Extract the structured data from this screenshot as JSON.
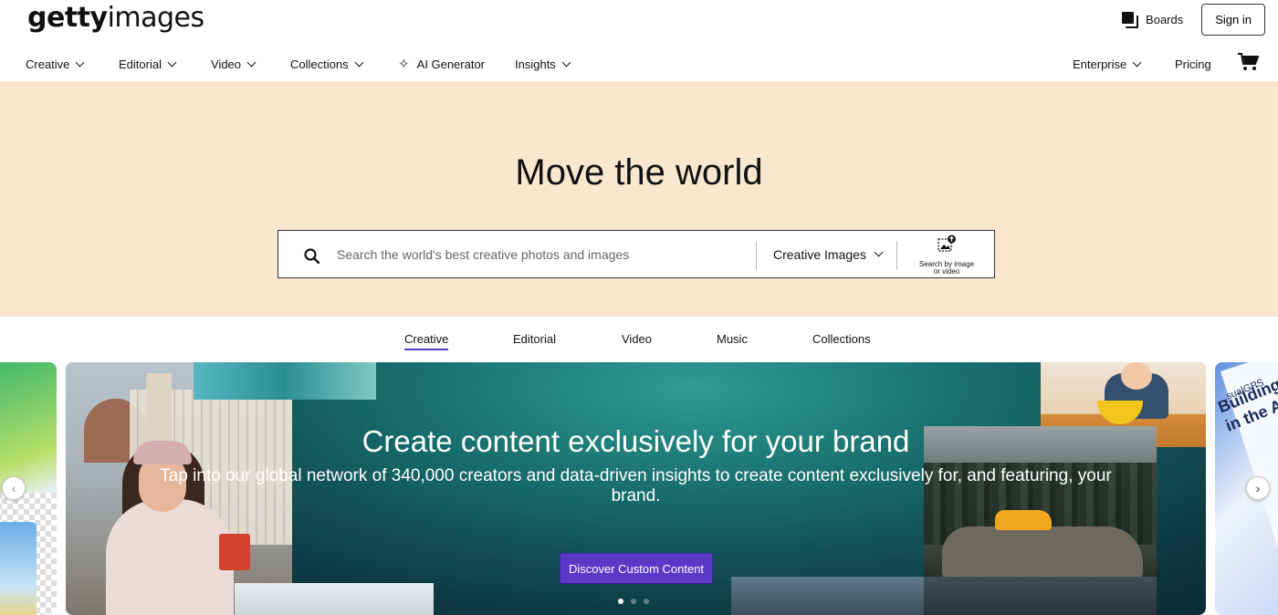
{
  "header": {
    "logo_bold": "getty",
    "logo_light": "images",
    "boards_label": "Boards",
    "signin_label": "Sign in"
  },
  "nav": {
    "items": [
      {
        "label": "Creative"
      },
      {
        "label": "Editorial"
      },
      {
        "label": "Video"
      },
      {
        "label": "Collections"
      },
      {
        "label": "AI Generator"
      },
      {
        "label": "Insights"
      }
    ],
    "enterprise_label": "Enterprise",
    "pricing_label": "Pricing"
  },
  "hero": {
    "title": "Move the world",
    "search_placeholder": "Search the world's best creative photos and images",
    "search_value": "",
    "type_selected": "Creative Images",
    "by_image_label": "Search by image or video"
  },
  "tabs": [
    {
      "label": "Creative",
      "active": true
    },
    {
      "label": "Editorial",
      "active": false
    },
    {
      "label": "Video",
      "active": false
    },
    {
      "label": "Music",
      "active": false
    },
    {
      "label": "Collections",
      "active": false
    }
  ],
  "carousel": {
    "title": "Create content exclusively for your brand",
    "subtitle": "Tap into our global network of 340,000 creators and data-driven insights to create content exclusively for, and featuring, your brand.",
    "cta_label": "Discover Custom Content",
    "slide_count": 3,
    "active_slide": 1,
    "right_card_small": "...sualGPS",
    "right_card_text": "Building T\nin the Ag"
  },
  "colors": {
    "hero_bg": "#f9e8cf",
    "accent": "#5b39c7"
  }
}
